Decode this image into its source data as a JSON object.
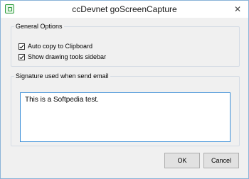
{
  "window": {
    "title": "ccDevnet goScreenCapture",
    "close_glyph": "✕"
  },
  "general_options": {
    "legend": "General Options",
    "items": [
      {
        "label": "Auto copy to Clipboard",
        "checked": true
      },
      {
        "label": "Show drawing tools sidebar",
        "checked": true
      }
    ]
  },
  "signature": {
    "legend": "Signature used when send email",
    "value": "This is a Softpedia test."
  },
  "buttons": {
    "ok_label": "OK",
    "cancel_label": "Cancel"
  },
  "colors": {
    "accent": "#3c8fd8",
    "app_icon": "#2a9a3a"
  }
}
